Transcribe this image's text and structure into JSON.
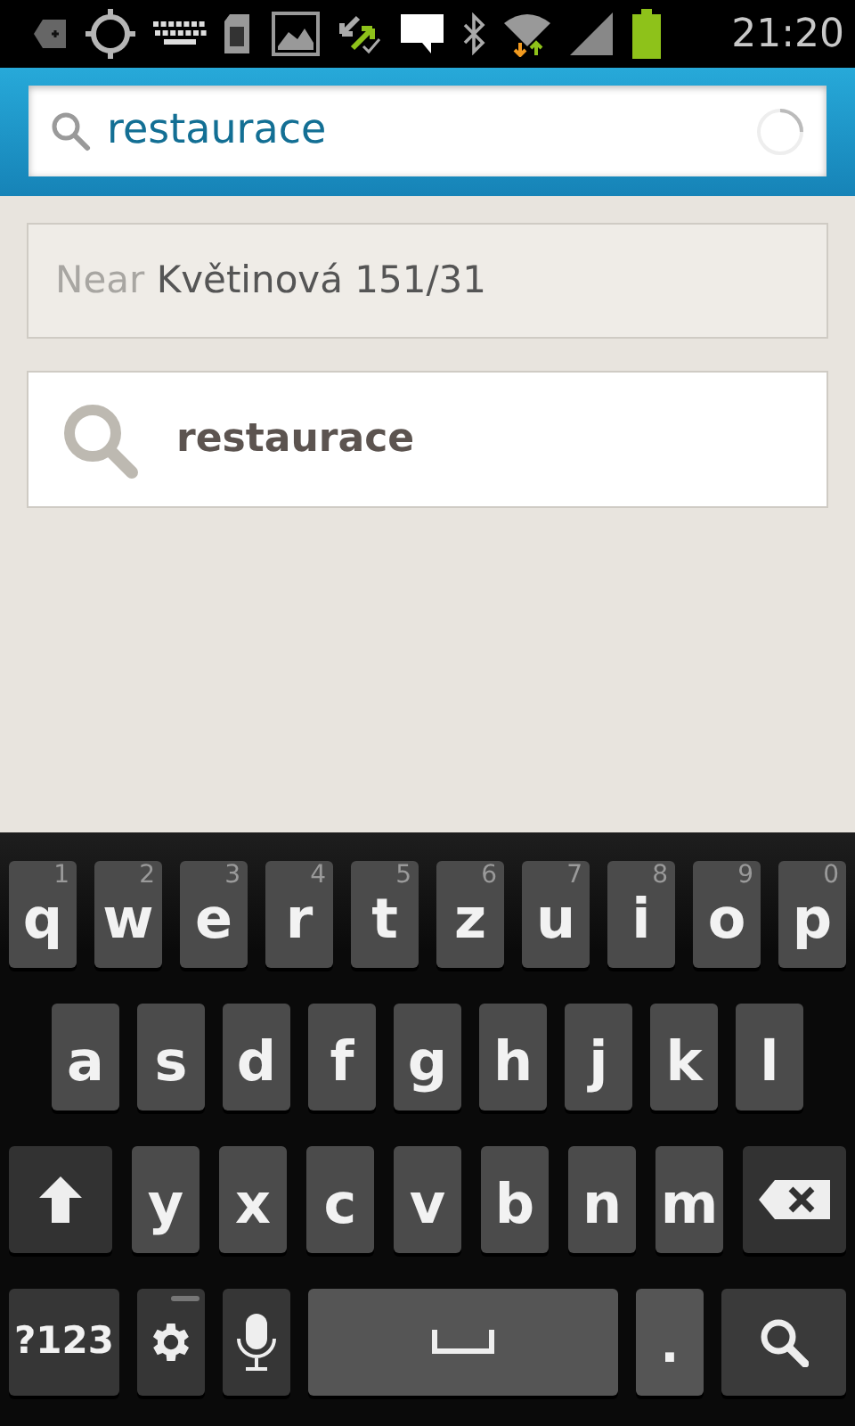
{
  "status_bar": {
    "time": "21:20"
  },
  "search": {
    "value": "restaurace"
  },
  "location": {
    "prefix": "Near",
    "address": "Květinová 151/31"
  },
  "suggestions": [
    {
      "text": "restaurace"
    }
  ],
  "keyboard": {
    "rows": [
      [
        {
          "kind": "letter",
          "label": "q",
          "hint": "1"
        },
        {
          "kind": "letter",
          "label": "w",
          "hint": "2"
        },
        {
          "kind": "letter",
          "label": "e",
          "hint": "3"
        },
        {
          "kind": "letter",
          "label": "r",
          "hint": "4"
        },
        {
          "kind": "letter",
          "label": "t",
          "hint": "5"
        },
        {
          "kind": "letter",
          "label": "z",
          "hint": "6"
        },
        {
          "kind": "letter",
          "label": "u",
          "hint": "7"
        },
        {
          "kind": "letter",
          "label": "i",
          "hint": "8"
        },
        {
          "kind": "letter",
          "label": "o",
          "hint": "9"
        },
        {
          "kind": "letter",
          "label": "p",
          "hint": "0"
        }
      ],
      [
        {
          "kind": "letter",
          "label": "a"
        },
        {
          "kind": "letter",
          "label": "s"
        },
        {
          "kind": "letter",
          "label": "d"
        },
        {
          "kind": "letter",
          "label": "f"
        },
        {
          "kind": "letter",
          "label": "g"
        },
        {
          "kind": "letter",
          "label": "h"
        },
        {
          "kind": "letter",
          "label": "j"
        },
        {
          "kind": "letter",
          "label": "k"
        },
        {
          "kind": "letter",
          "label": "l"
        }
      ],
      [
        {
          "kind": "shift"
        },
        {
          "kind": "letter",
          "label": "y"
        },
        {
          "kind": "letter",
          "label": "x"
        },
        {
          "kind": "letter",
          "label": "c"
        },
        {
          "kind": "letter",
          "label": "v"
        },
        {
          "kind": "letter",
          "label": "b"
        },
        {
          "kind": "letter",
          "label": "n"
        },
        {
          "kind": "letter",
          "label": "m"
        },
        {
          "kind": "backspace"
        }
      ],
      [
        {
          "kind": "symbols",
          "label": "?123"
        },
        {
          "kind": "settings"
        },
        {
          "kind": "mic"
        },
        {
          "kind": "space"
        },
        {
          "kind": "period",
          "label": "."
        },
        {
          "kind": "search"
        }
      ]
    ]
  }
}
